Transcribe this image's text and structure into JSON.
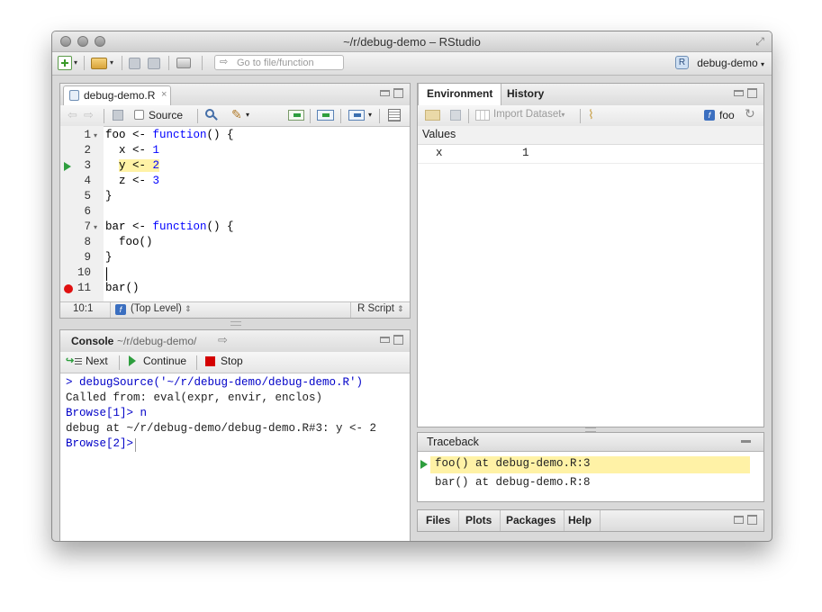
{
  "window": {
    "title": "~/r/debug-demo – RStudio"
  },
  "main_toolbar": {
    "goto_placeholder": "Go to file/function",
    "project_name": "debug-demo",
    "project_icon_glyph": "R"
  },
  "source_pane": {
    "tab_label": "debug-demo.R",
    "tab_close": "×",
    "source_label": "Source",
    "lines": [
      {
        "n": "1",
        "fold": "▾",
        "parts": [
          {
            "t": "foo <- ",
            "c": ""
          },
          {
            "t": "function",
            "c": "kw"
          },
          {
            "t": "() {",
            "c": ""
          }
        ]
      },
      {
        "n": "2",
        "fold": "",
        "parts": [
          {
            "t": "  x <- ",
            "c": ""
          },
          {
            "t": "1",
            "c": "num"
          }
        ]
      },
      {
        "n": "3",
        "fold": "",
        "parts": [
          {
            "t": "  y <- ",
            "c": ""
          },
          {
            "t": "2",
            "c": "num"
          }
        ]
      },
      {
        "n": "4",
        "fold": "",
        "parts": [
          {
            "t": "  z <- ",
            "c": ""
          },
          {
            "t": "3",
            "c": "num"
          }
        ]
      },
      {
        "n": "5",
        "fold": "",
        "parts": [
          {
            "t": "}",
            "c": ""
          }
        ]
      },
      {
        "n": "6",
        "fold": "",
        "parts": []
      },
      {
        "n": "7",
        "fold": "▾",
        "parts": [
          {
            "t": "bar <- ",
            "c": ""
          },
          {
            "t": "function",
            "c": "kw"
          },
          {
            "t": "() {",
            "c": ""
          }
        ]
      },
      {
        "n": "8",
        "fold": "",
        "parts": [
          {
            "t": "  foo()",
            "c": ""
          }
        ]
      },
      {
        "n": "9",
        "fold": "",
        "parts": [
          {
            "t": "}",
            "c": ""
          }
        ]
      },
      {
        "n": "10",
        "fold": "",
        "parts": []
      },
      {
        "n": "11",
        "fold": "",
        "parts": [
          {
            "t": "bar()",
            "c": ""
          }
        ]
      }
    ],
    "current_line": "3",
    "breakpoint_line": "11",
    "status": {
      "position": "10:1",
      "scope_icon": "f",
      "scope": "(Top Level)",
      "scope_arrows": "⇕",
      "filetype": "R Script",
      "filetype_arrows": "⇕"
    }
  },
  "console_pane": {
    "title": "Console",
    "path": "~/r/debug-demo/",
    "buttons": {
      "next": "Next",
      "continue": "Continue",
      "stop": "Stop"
    },
    "lines": [
      {
        "text": "> debugSource('~/r/debug-demo/debug-demo.R')",
        "style": "blue"
      },
      {
        "text": "Called from: eval(expr, envir, enclos)",
        "style": ""
      },
      {
        "text": "Browse[1]> n",
        "style": "blue"
      },
      {
        "text": "debug at ~/r/debug-demo/debug-demo.R#3: y <- 2",
        "style": ""
      },
      {
        "text": "Browse[2]> ",
        "style": "blue"
      }
    ]
  },
  "environment_pane": {
    "tabs": [
      "Environment",
      "History"
    ],
    "import_label": "Import Dataset",
    "import_arrow": "▾",
    "function_icon": "f",
    "function_name": "foo",
    "values_header": "Values",
    "variables": [
      {
        "name": "x",
        "value": "1"
      }
    ]
  },
  "traceback_pane": {
    "title": "Traceback",
    "frames": [
      {
        "text": "foo() at debug-demo.R:3",
        "current": true
      },
      {
        "text": "bar() at debug-demo.R:8",
        "current": false
      }
    ]
  },
  "files_pane": {
    "tabs": [
      "Files",
      "Plots",
      "Packages",
      "Help"
    ]
  },
  "colors": {
    "accent_green": "#2e9e3e",
    "breakpoint_red": "#e01010",
    "highlight_yellow": "#fff2a6",
    "stop_red": "#d40000"
  }
}
